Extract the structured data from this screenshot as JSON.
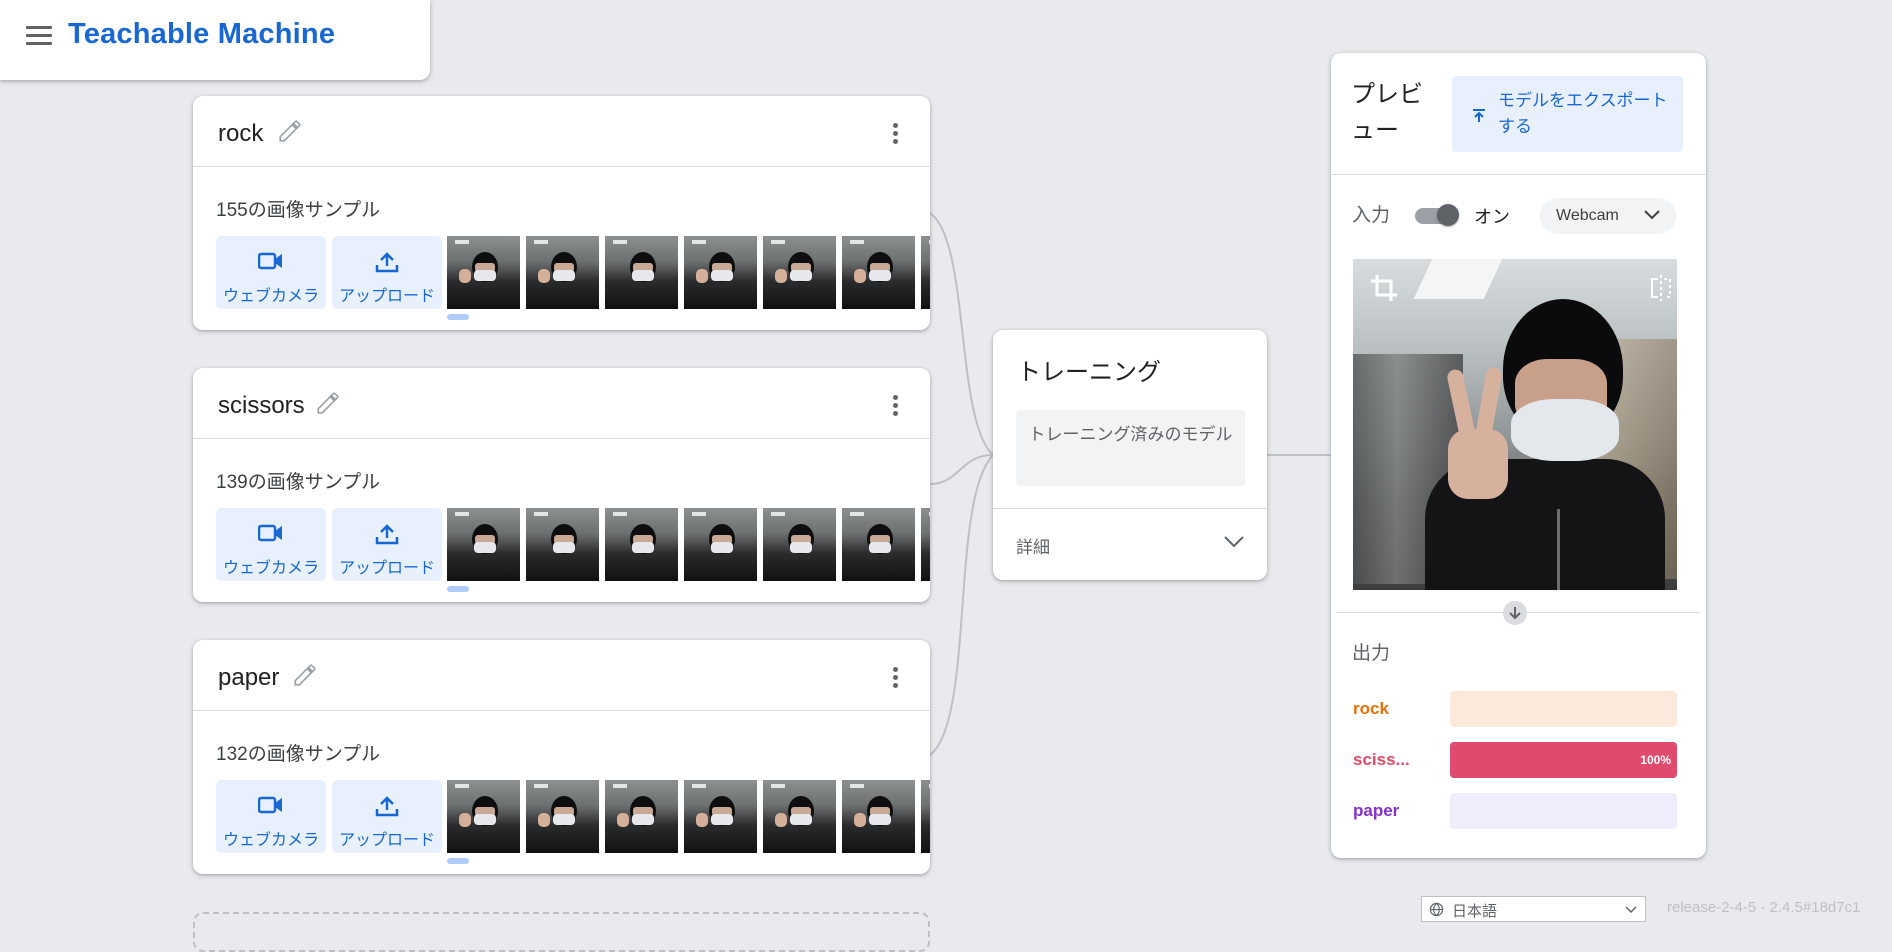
{
  "header": {
    "title": "Teachable Machine"
  },
  "classes": [
    {
      "name": "rock",
      "sample_count": "155の画像サンプル",
      "webcam_label": "ウェブカメラ",
      "upload_label": "アップロード"
    },
    {
      "name": "scissors",
      "sample_count": "139の画像サンプル",
      "webcam_label": "ウェブカメラ",
      "upload_label": "アップロード"
    },
    {
      "name": "paper",
      "sample_count": "132の画像サンプル",
      "webcam_label": "ウェブカメラ",
      "upload_label": "アップロード"
    }
  ],
  "training": {
    "title": "トレーニング",
    "button_label": "トレーニング済みのモデル",
    "advanced_label": "詳細"
  },
  "preview": {
    "title": "プレビュー",
    "export_label": "モデルをエクスポートする",
    "input_label": "入力",
    "toggle_label": "オン",
    "toggle_on": true,
    "source_select": "Webcam",
    "output_label": "出力",
    "outputs": [
      {
        "name": "rock",
        "value": 0,
        "percent": "",
        "color": "#e8710a",
        "bg": "#fde9dc"
      },
      {
        "name": "sciss...",
        "value": 1.0,
        "percent": "100%",
        "color": "#e04a6c",
        "bg": "#fbe0e6"
      },
      {
        "name": "paper",
        "value": 0,
        "percent": "",
        "color": "#8430ce",
        "bg": "#efecfb"
      }
    ]
  },
  "footer": {
    "language": "日本語",
    "release": "release-2-4-5 - 2.4.5#18d7c1"
  },
  "colors": {
    "accent": "#1967d2",
    "background": "#e8eaed"
  },
  "icons": {
    "menu": "menu-icon",
    "edit": "pencil-icon",
    "more": "more-vert-icon",
    "webcam": "videocam-icon",
    "upload": "upload-icon",
    "export": "upload-icon",
    "crop": "crop-icon",
    "flip": "flip-icon",
    "arrow": "arrow-down-icon",
    "globe": "globe-icon"
  }
}
